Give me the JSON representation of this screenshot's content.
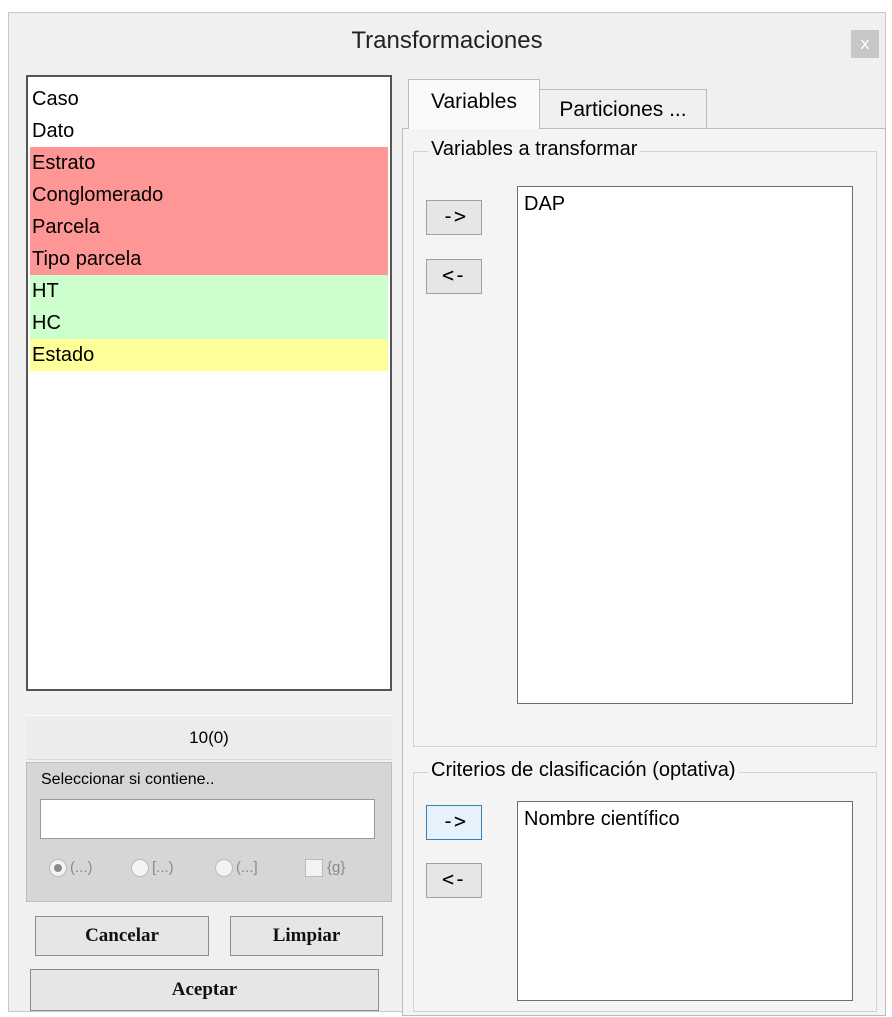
{
  "window": {
    "title": "Transformaciones",
    "close_label": "x"
  },
  "left": {
    "variables": [
      {
        "label": "Caso",
        "highlight": "none"
      },
      {
        "label": "Dato",
        "highlight": "none"
      },
      {
        "label": "Estrato",
        "highlight": "red"
      },
      {
        "label": "Conglomerado",
        "highlight": "red"
      },
      {
        "label": "Parcela",
        "highlight": "red"
      },
      {
        "label": "Tipo parcela",
        "highlight": "red"
      },
      {
        "label": "HT",
        "highlight": "green"
      },
      {
        "label": "HC",
        "highlight": "green"
      },
      {
        "label": "Estado",
        "highlight": "yellow"
      }
    ],
    "count": "10(0)",
    "filter": {
      "label": "Seleccionar si contiene..",
      "value": "",
      "options": [
        {
          "label": "(...)",
          "type": "radio",
          "checked": true
        },
        {
          "label": "[...)",
          "type": "radio",
          "checked": false
        },
        {
          "label": "(...]",
          "type": "radio",
          "checked": false
        },
        {
          "label": "{g}",
          "type": "checkbox",
          "checked": false
        }
      ]
    },
    "buttons": {
      "cancel": "Cancelar",
      "clear": "Limpiar",
      "accept": "Aceptar"
    }
  },
  "right": {
    "tabs": [
      {
        "label": "Variables",
        "active": true
      },
      {
        "label": "Particiones ...",
        "active": false
      }
    ],
    "transform_group": {
      "title": "Variables a transformar",
      "add_label": "->",
      "remove_label": "<-",
      "items": [
        "DAP"
      ]
    },
    "criteria_group": {
      "title": "Criterios de clasificación (optativa)",
      "add_label": "->",
      "remove_label": "<-",
      "items": [
        "Nombre científico"
      ]
    }
  },
  "colors": {
    "red_highlight": "#ff9696",
    "green_highlight": "#ccffcc",
    "yellow_highlight": "#ffff99",
    "focus_border": "#3c7fb1"
  }
}
